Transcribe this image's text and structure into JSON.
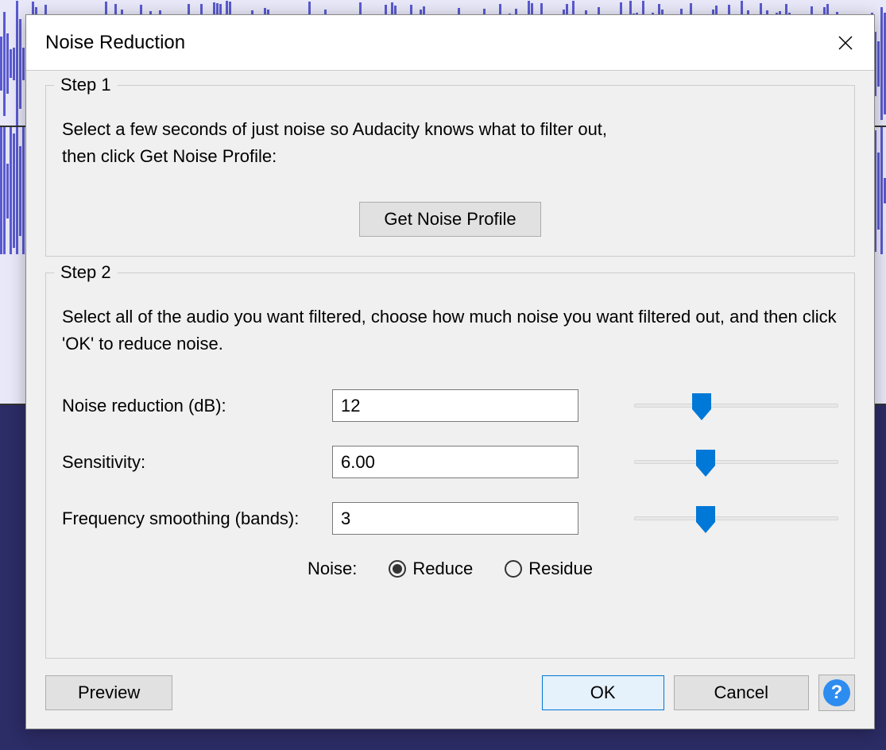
{
  "dialog": {
    "title": "Noise Reduction"
  },
  "step1": {
    "legend": "Step 1",
    "instruction": "Select a few seconds of just noise so Audacity knows what to filter out,\nthen click Get Noise Profile:",
    "buttonLabel": "Get Noise Profile"
  },
  "step2": {
    "legend": "Step 2",
    "instruction": "Select all of the audio you want filtered, choose how much noise you want filtered out, and then click 'OK' to reduce noise.",
    "controls": {
      "noiseReduction": {
        "label": "Noise reduction (dB):",
        "value": "12",
        "sliderPct": 33
      },
      "sensitivity": {
        "label": "Sensitivity:",
        "value": "6.00",
        "sliderPct": 35
      },
      "freqSmoothing": {
        "label": "Frequency smoothing (bands):",
        "value": "3",
        "sliderPct": 35
      }
    },
    "radio": {
      "heading": "Noise:",
      "reduce": "Reduce",
      "residue": "Residue",
      "selected": "reduce"
    }
  },
  "buttons": {
    "preview": "Preview",
    "ok": "OK",
    "cancel": "Cancel",
    "help": "?"
  },
  "colors": {
    "sliderThumb": "#0078d7",
    "primaryBorder": "#0078d7",
    "primaryBg": "#e5f1fb"
  }
}
